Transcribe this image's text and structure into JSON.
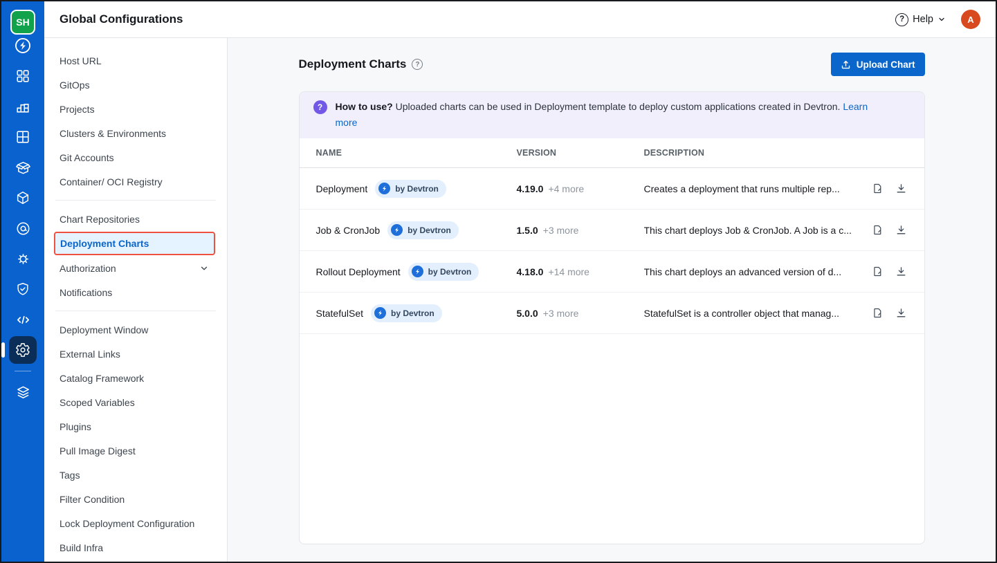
{
  "rail": {
    "logo_text": "SH",
    "icons": [
      "devtron-logo",
      "apps",
      "app-group",
      "jobs",
      "chart-store",
      "resource-browser",
      "at-circle",
      "wheel",
      "shield-check",
      "code",
      "gear",
      "stack"
    ]
  },
  "topbar": {
    "title": "Global Configurations",
    "help_label": "Help",
    "avatar_initial": "A"
  },
  "sidebar": {
    "groups": [
      {
        "items": [
          "Host URL",
          "GitOps",
          "Projects",
          "Clusters & Environments",
          "Git Accounts",
          "Container/ OCI Registry"
        ]
      },
      {
        "items": [
          "Chart Repositories",
          "Deployment Charts",
          "Authorization",
          "Notifications"
        ]
      },
      {
        "items": [
          "Deployment Window",
          "External Links",
          "Catalog Framework",
          "Scoped Variables",
          "Plugins",
          "Pull Image Digest",
          "Tags",
          "Filter Condition",
          "Lock Deployment Configuration",
          "Build Infra"
        ]
      }
    ],
    "selected": "Deployment Charts"
  },
  "main": {
    "title": "Deployment Charts",
    "upload_button": "Upload Chart",
    "banner": {
      "bold": "How to use?",
      "text": " Uploaded charts can be used in Deployment template to deploy custom applications created in Devtron. ",
      "link": "Learn more"
    },
    "table": {
      "columns": {
        "name": "NAME",
        "version": "VERSION",
        "description": "DESCRIPTION"
      },
      "rows": [
        {
          "name": "Deployment",
          "badge": "by Devtron",
          "version": "4.19.0",
          "more": "+4 more",
          "description": "Creates a deployment that runs multiple rep..."
        },
        {
          "name": "Job & CronJob",
          "badge": "by Devtron",
          "version": "1.5.0",
          "more": "+3 more",
          "description": "This chart deploys Job & CronJob. A Job is a c..."
        },
        {
          "name": "Rollout Deployment",
          "badge": "by Devtron",
          "version": "4.18.0",
          "more": "+14 more",
          "description": "This chart deploys an advanced version of d..."
        },
        {
          "name": "StatefulSet",
          "badge": "by Devtron",
          "version": "5.0.0",
          "more": "+3 more",
          "description": "StatefulSet is a controller object that manag..."
        }
      ]
    }
  },
  "colors": {
    "rail_blue": "#0962CE",
    "accent_blue": "#0A66CB",
    "selected_bg": "#E5F2FF",
    "highlight_red": "#F0513F",
    "banner_bg": "#F1EFFB",
    "banner_icon_purple": "#7357E6",
    "avatar_orange": "#D9491F",
    "logo_green": "#12A24C"
  }
}
